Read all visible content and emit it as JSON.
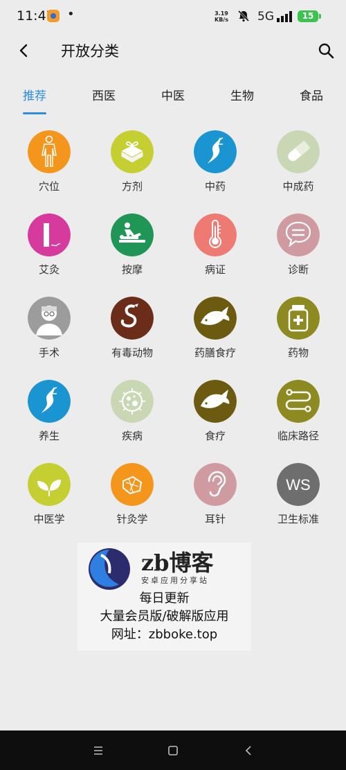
{
  "status": {
    "time": "11:47",
    "dot": "•",
    "speed_value": "3.19",
    "speed_unit": "KB/s",
    "network": "5G",
    "battery": "15"
  },
  "header": {
    "title": "开放分类"
  },
  "tabs": [
    "推荐",
    "西医",
    "中医",
    "生物",
    "食品"
  ],
  "categories": [
    {
      "label": "穴位",
      "color": "#f5961c",
      "icon": "body-icon"
    },
    {
      "label": "方剂",
      "color": "#c5cf31",
      "icon": "herb-pack-icon"
    },
    {
      "label": "中药",
      "color": "#1b95d1",
      "icon": "ginseng-icon"
    },
    {
      "label": "中成药",
      "color": "#c9d7b4",
      "icon": "pill-icon"
    },
    {
      "label": "艾灸",
      "color": "#d63a9d",
      "icon": "moxa-icon"
    },
    {
      "label": "按摩",
      "color": "#1f9656",
      "icon": "massage-icon"
    },
    {
      "label": "病证",
      "color": "#ee7a74",
      "icon": "thermometer-icon"
    },
    {
      "label": "诊断",
      "color": "#cf9aa0",
      "icon": "chat-icon"
    },
    {
      "label": "手术",
      "color": "#9c9c9c",
      "icon": "surgeon-icon"
    },
    {
      "label": "有毒动物",
      "color": "#6b2d1a",
      "icon": "snake-icon"
    },
    {
      "label": "药膳食疗",
      "color": "#6b5a0f",
      "icon": "fish-icon"
    },
    {
      "label": "药物",
      "color": "#8d8a21",
      "icon": "medicine-bottle-icon"
    },
    {
      "label": "养生",
      "color": "#1b95d1",
      "icon": "ginseng-icon"
    },
    {
      "label": "疾病",
      "color": "#c9d7b4",
      "icon": "virus-icon"
    },
    {
      "label": "食疗",
      "color": "#6b5a0f",
      "icon": "fish-icon"
    },
    {
      "label": "临床路径",
      "color": "#8d8a21",
      "icon": "path-icon"
    },
    {
      "label": "中医学",
      "color": "#c5cf31",
      "icon": "leaf-icon"
    },
    {
      "label": "针灸学",
      "color": "#f5961c",
      "icon": "needle-icon"
    },
    {
      "label": "耳针",
      "color": "#cf9aa0",
      "icon": "ear-icon"
    },
    {
      "label": "卫生标准",
      "color": "#6e6e6e",
      "icon": "ws-icon",
      "icon_text": "WS"
    }
  ],
  "banner": {
    "brand": "zb博客",
    "subtitle": "安卓应用分享站",
    "line1": "每日更新",
    "line2": "大量会员版/破解版应用",
    "line3": "网址：zbboke.top"
  },
  "nav": {
    "items": [
      "menu-icon",
      "home-icon",
      "back-icon"
    ]
  }
}
